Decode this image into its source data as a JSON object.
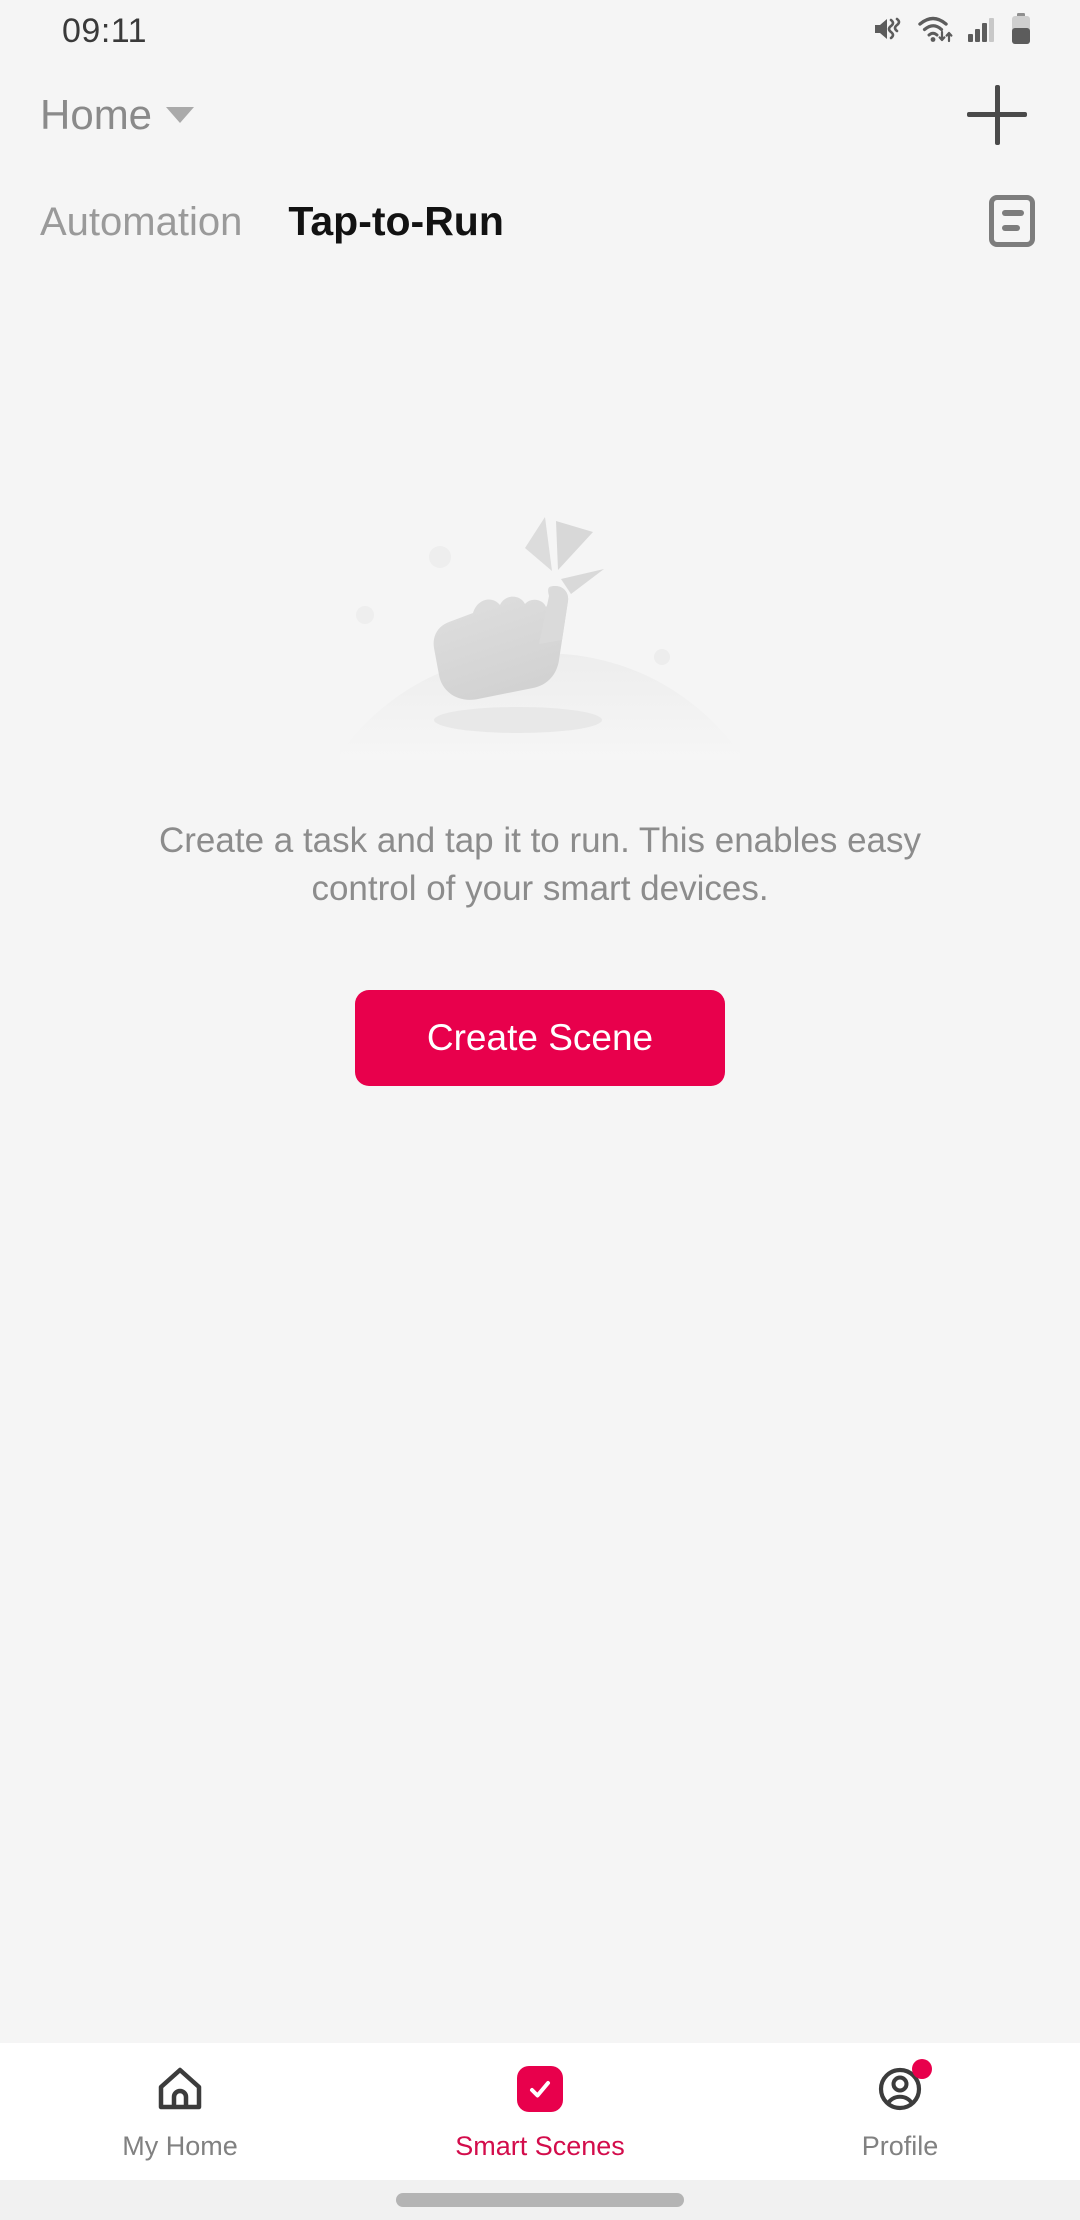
{
  "status_bar": {
    "time": "09:11",
    "icons": [
      {
        "name": "mute-vibrate-icon",
        "label": "sound muted"
      },
      {
        "name": "wifi-icon",
        "label": "wifi connected"
      },
      {
        "name": "cellular-signal-icon",
        "label": "signal 3 of 4 bars"
      },
      {
        "name": "battery-icon",
        "label": "battery 55%"
      }
    ],
    "battery_level_percent": 55,
    "signal_bars": 3
  },
  "header": {
    "home_label": "Home",
    "dropdown_icon": "chevron-down-icon",
    "add_icon": "plus-icon"
  },
  "tabs": {
    "items": [
      {
        "label": "Automation",
        "active": false
      },
      {
        "label": "Tap-to-Run",
        "active": true
      }
    ],
    "automation_label": "Automation",
    "tap_to_run_label": "Tap-to-Run",
    "list_icon": "scene-log-icon"
  },
  "empty_state": {
    "illustration": "tap-hand-icon",
    "description": "Create a task and tap it to run. This enables easy control of your smart devices.",
    "button_label": "Create Scene"
  },
  "bottom_nav": {
    "items": [
      {
        "label": "My Home",
        "icon": "home-icon",
        "active": false,
        "badge": false
      },
      {
        "label": "Smart Scenes",
        "icon": "checkmark-square-icon",
        "active": true,
        "badge": false
      },
      {
        "label": "Profile",
        "icon": "account-circle-icon",
        "active": false,
        "badge": true
      }
    ],
    "my_home_label": "My Home",
    "smart_scenes_label": "Smart Scenes",
    "profile_label": "Profile"
  },
  "colors": {
    "accent": "#e8004c",
    "accent_text": "#d30c4b",
    "background": "#f5f5f5",
    "nav_background": "#ffffff",
    "active_tab_text": "#121212",
    "inactive_tab_text": "#9a9a9a",
    "body_text": "#8c8c8c"
  }
}
